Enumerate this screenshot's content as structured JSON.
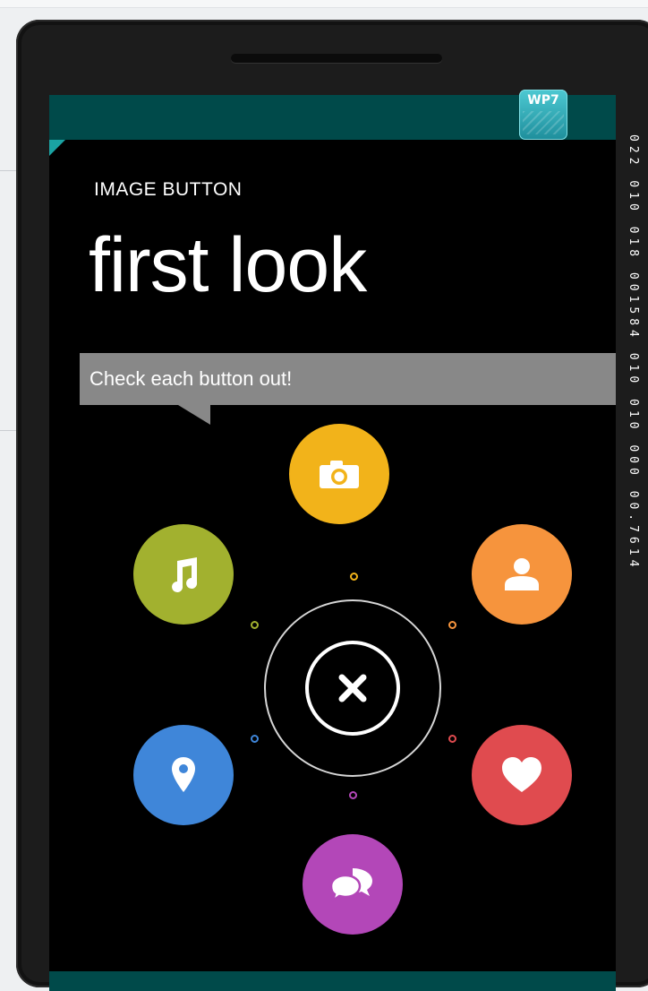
{
  "header": {
    "app_title": "IMAGE BUTTON",
    "page_title": "first look",
    "badge": "WP7"
  },
  "tooltip": {
    "text": "Check each button out!"
  },
  "perf_counter": "022 010 018 001584 010 010 000 00.7614",
  "radial_menu": {
    "buttons": [
      {
        "id": "camera",
        "icon": "camera-icon",
        "color": "#f2b31a"
      },
      {
        "id": "music",
        "icon": "music-note-icon",
        "color": "#a2b12f"
      },
      {
        "id": "contact",
        "icon": "person-icon",
        "color": "#f6943d"
      },
      {
        "id": "location",
        "icon": "map-pin-icon",
        "color": "#3f86d9"
      },
      {
        "id": "favorite",
        "icon": "heart-icon",
        "color": "#e04b4f"
      },
      {
        "id": "messages",
        "icon": "chat-bubbles-icon",
        "color": "#b347b8"
      }
    ],
    "center": {
      "icon": "close-icon",
      "ring_color": "#ffffff"
    }
  },
  "colors": {
    "accent_bar": "#004a4a",
    "tooltip_bg": "#888888",
    "screen_bg": "#000000"
  }
}
